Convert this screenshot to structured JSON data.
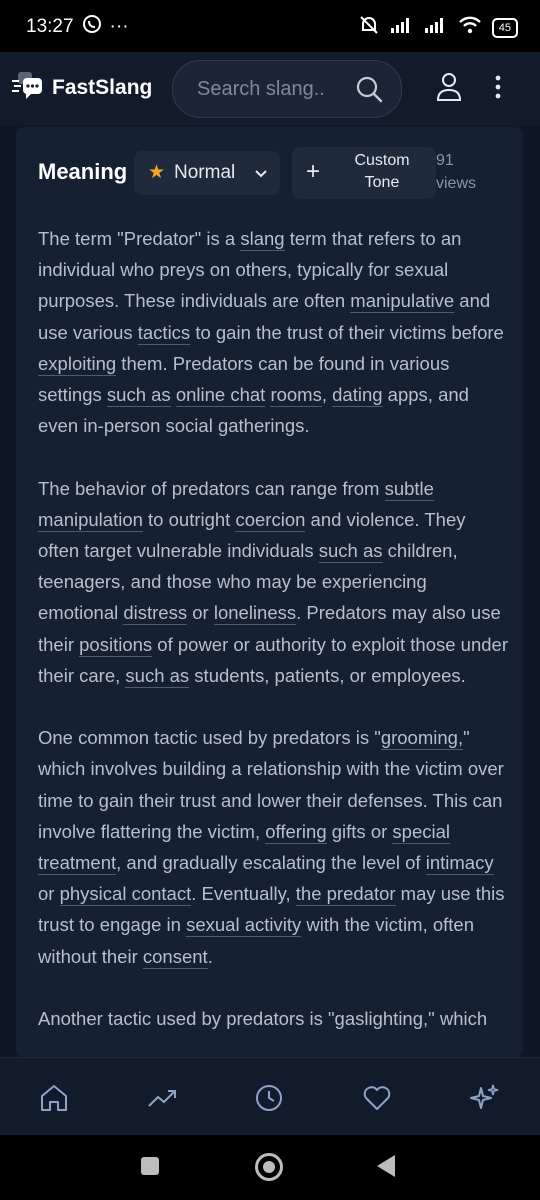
{
  "status_bar": {
    "time": "13:27",
    "dots": "···",
    "battery": "45"
  },
  "app_bar": {
    "title": "FastSlang",
    "search_placeholder": "Search slang.."
  },
  "meaning": {
    "title": "Meaning",
    "tone_label": "Normal",
    "custom_tone_label": "Custom Tone",
    "views_count": "91",
    "views_label": "views"
  },
  "paragraphs": [
    [
      {
        "t": "The term \"Predator\" is a "
      },
      {
        "t": "slang",
        "u": true
      },
      {
        "t": " term that refers to an individual who preys on others, typically for sexual purposes. These individuals are often "
      },
      {
        "t": "manipulative",
        "u": true
      },
      {
        "t": " and use various "
      },
      {
        "t": "tactics",
        "u": true
      },
      {
        "t": " to gain the trust of their victims before "
      },
      {
        "t": "exploiting",
        "u": true
      },
      {
        "t": " them. Predators can be found in various settings "
      },
      {
        "t": "such as",
        "u": true
      },
      {
        "t": " "
      },
      {
        "t": "online chat",
        "u": true
      },
      {
        "t": " "
      },
      {
        "t": "rooms",
        "u": true
      },
      {
        "t": ", "
      },
      {
        "t": "dating",
        "u": true
      },
      {
        "t": " apps, and even in-person social gatherings."
      }
    ],
    [
      {
        "t": "The behavior of predators can range from "
      },
      {
        "t": "subtle manipulation",
        "u": true
      },
      {
        "t": " to outright "
      },
      {
        "t": "coercion",
        "u": true
      },
      {
        "t": " and violence. They often target vulnerable individuals "
      },
      {
        "t": "such as",
        "u": true
      },
      {
        "t": " children, teenagers, and those who may be experiencing emotional "
      },
      {
        "t": "distress",
        "u": true
      },
      {
        "t": " or "
      },
      {
        "t": "loneliness",
        "u": true
      },
      {
        "t": ". Predators may also use their "
      },
      {
        "t": "positions",
        "u": true
      },
      {
        "t": " of power or authority to exploit those under their care, "
      },
      {
        "t": "such as",
        "u": true
      },
      {
        "t": " students, patients, or employees."
      }
    ],
    [
      {
        "t": "One common tactic used by predators is \""
      },
      {
        "t": "grooming,",
        "u": true
      },
      {
        "t": "\" which involves building a relationship with the victim over time to gain their trust and lower their defenses. This can involve flattering the victim, "
      },
      {
        "t": "offering",
        "u": true
      },
      {
        "t": " gifts or "
      },
      {
        "t": "special treatment",
        "u": true
      },
      {
        "t": ", and gradually escalating the level of "
      },
      {
        "t": "intimacy",
        "u": true
      },
      {
        "t": " or "
      },
      {
        "t": "physical contact",
        "u": true
      },
      {
        "t": ". Eventually, "
      },
      {
        "t": "the predator",
        "u": true
      },
      {
        "t": " may use this trust to engage in "
      },
      {
        "t": "sexual activity",
        "u": true
      },
      {
        "t": " with the victim, often without their "
      },
      {
        "t": "consent",
        "u": true
      },
      {
        "t": "."
      }
    ],
    [
      {
        "t": "Another tactic used by predators is \"gaslighting,\" which"
      }
    ]
  ],
  "bottom_nav": [
    "home-icon",
    "trending-icon",
    "history-icon",
    "favorites-icon",
    "sparkles-icon"
  ],
  "colors": {
    "background": "#0f1726",
    "card": "#162033",
    "accent": "#f5a524"
  }
}
